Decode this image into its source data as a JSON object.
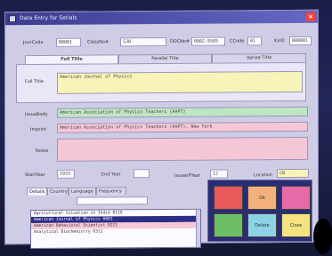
{
  "window": {
    "title": "Data Entry for Serials"
  },
  "header_fields": {
    "journal_code": {
      "label": "JourCode",
      "value": "00001"
    },
    "class_no": {
      "label": "ClassNo#",
      "value": "530"
    },
    "ddc_no": {
      "label": "DDCNo#",
      "value": "0002-9505"
    },
    "c_code": {
      "label": "CCode",
      "value": "01"
    },
    "kx_id": {
      "label": "KxID",
      "value": "000001"
    }
  },
  "title_tabs": [
    "Full Title",
    "Parallel Title",
    "Varied Title"
  ],
  "full_title": {
    "label": "Full Title",
    "value": "American Journal of Physics"
  },
  "issue_body": {
    "label": "IssueBody",
    "value": "American Association of Physics Teachers (AAPT)"
  },
  "imprint": {
    "label": "Imprint",
    "value": "American Association of Physics Teachers (AAPT), New York"
  },
  "notes": {
    "label": "Notes",
    "value": ""
  },
  "start_year": {
    "label": "StartYear",
    "value": "1933"
  },
  "end_year": {
    "label": "End Year",
    "value": ""
  },
  "issues_per_year": {
    "label": "IssuesPYear",
    "value": "12"
  },
  "location": {
    "label": "Location",
    "value": "CN"
  },
  "bottom_tabs": [
    "Details",
    "Country",
    "Language",
    "Frequency"
  ],
  "list": [
    {
      "text": "Agricultural Situation in India   0129"
    },
    {
      "text": "American Journal of Physics   0001"
    },
    {
      "text": "American Behavioral Scientist   0221"
    },
    {
      "text": "Analytical Biochemistry   0311"
    }
  ],
  "buttons": [
    {
      "label": "",
      "color": "#e85a5a"
    },
    {
      "label": "Ok",
      "color": "#f3b27d"
    },
    {
      "label": "",
      "color": "#e66aa8"
    },
    {
      "label": "",
      "color": "#6cbf67"
    },
    {
      "label": "Delete",
      "color": "#8ed2e8"
    },
    {
      "label": "Close",
      "color": "#f4e481"
    }
  ]
}
